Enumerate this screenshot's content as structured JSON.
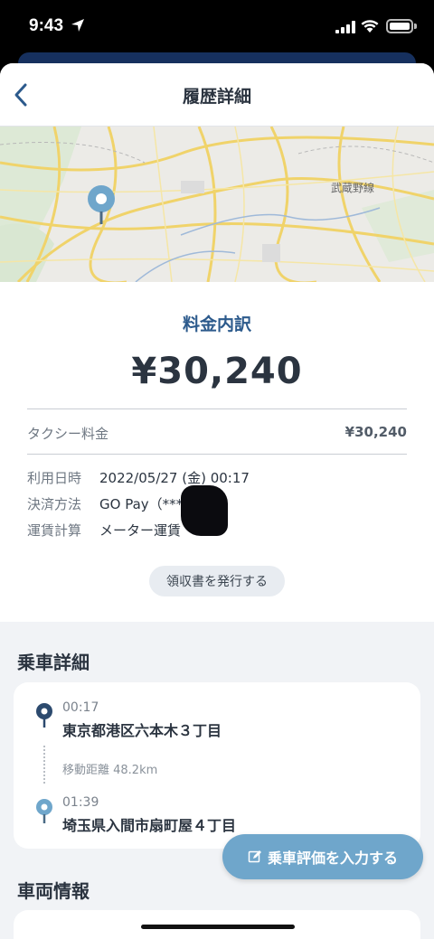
{
  "status_bar": {
    "time": "9:43"
  },
  "header": {
    "title": "履歴詳細"
  },
  "map": {
    "line_label": "武蔵野線",
    "pin_color": "#6fa6cb"
  },
  "fare": {
    "title": "料金内訳",
    "total": "¥30,240",
    "taxi_fare_label": "タクシー料金",
    "taxi_fare_value": "¥30,240",
    "date_label": "利用日時",
    "date_value": "2022/05/27 (金) 00:17",
    "payment_label": "決済方法",
    "payment_value": "GO Pay（****",
    "calc_label": "運賃計算",
    "calc_value": "メーター運賃",
    "receipt_button": "領収書を発行する"
  },
  "ride": {
    "section_title": "乗車詳細",
    "pickup_time": "00:17",
    "pickup_address": "東京都港区六本木３丁目",
    "distance": "移動距離 48.2km",
    "dropoff_time": "01:39",
    "dropoff_address": "埼玉県入間市扇町屋４丁目"
  },
  "rate_button": "乗車評価を入力する",
  "vehicle": {
    "section_title": "車両情報"
  },
  "colors": {
    "accent": "#2c5a8c",
    "button": "#6fa6cb",
    "text": "#2b3440"
  }
}
